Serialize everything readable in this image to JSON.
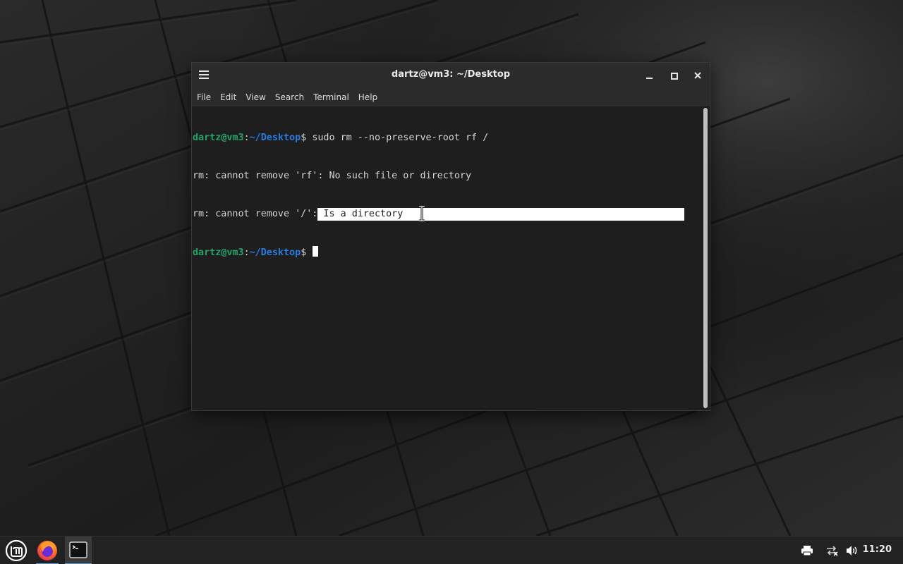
{
  "window": {
    "title": "dartz@vm3: ~/Desktop",
    "menu": [
      "File",
      "Edit",
      "View",
      "Search",
      "Terminal",
      "Help"
    ]
  },
  "terminal": {
    "prompt_user": "dartz@vm3",
    "prompt_colon": ":",
    "prompt_path": "~/Desktop",
    "prompt_symbol": "$ ",
    "command": "sudo rm --no-preserve-root rf /",
    "output_line_1": "rm: cannot remove 'rf': No such file or directory",
    "output_line_2_prefix": "rm: cannot remove '/':",
    "output_line_2_selected": " Is a directory"
  },
  "taskbar": {
    "clock": "11:20",
    "icons": [
      "mint-menu-icon",
      "firefox-icon",
      "terminal-icon",
      "printer-icon",
      "network-icon",
      "volume-icon"
    ]
  },
  "colors": {
    "prompt_user": "#26a269",
    "prompt_path": "#2a7bde",
    "terminal_bg": "#1e1e1e",
    "taskbar_bg": "#222222",
    "active_indicator": "#5aa0d8"
  }
}
